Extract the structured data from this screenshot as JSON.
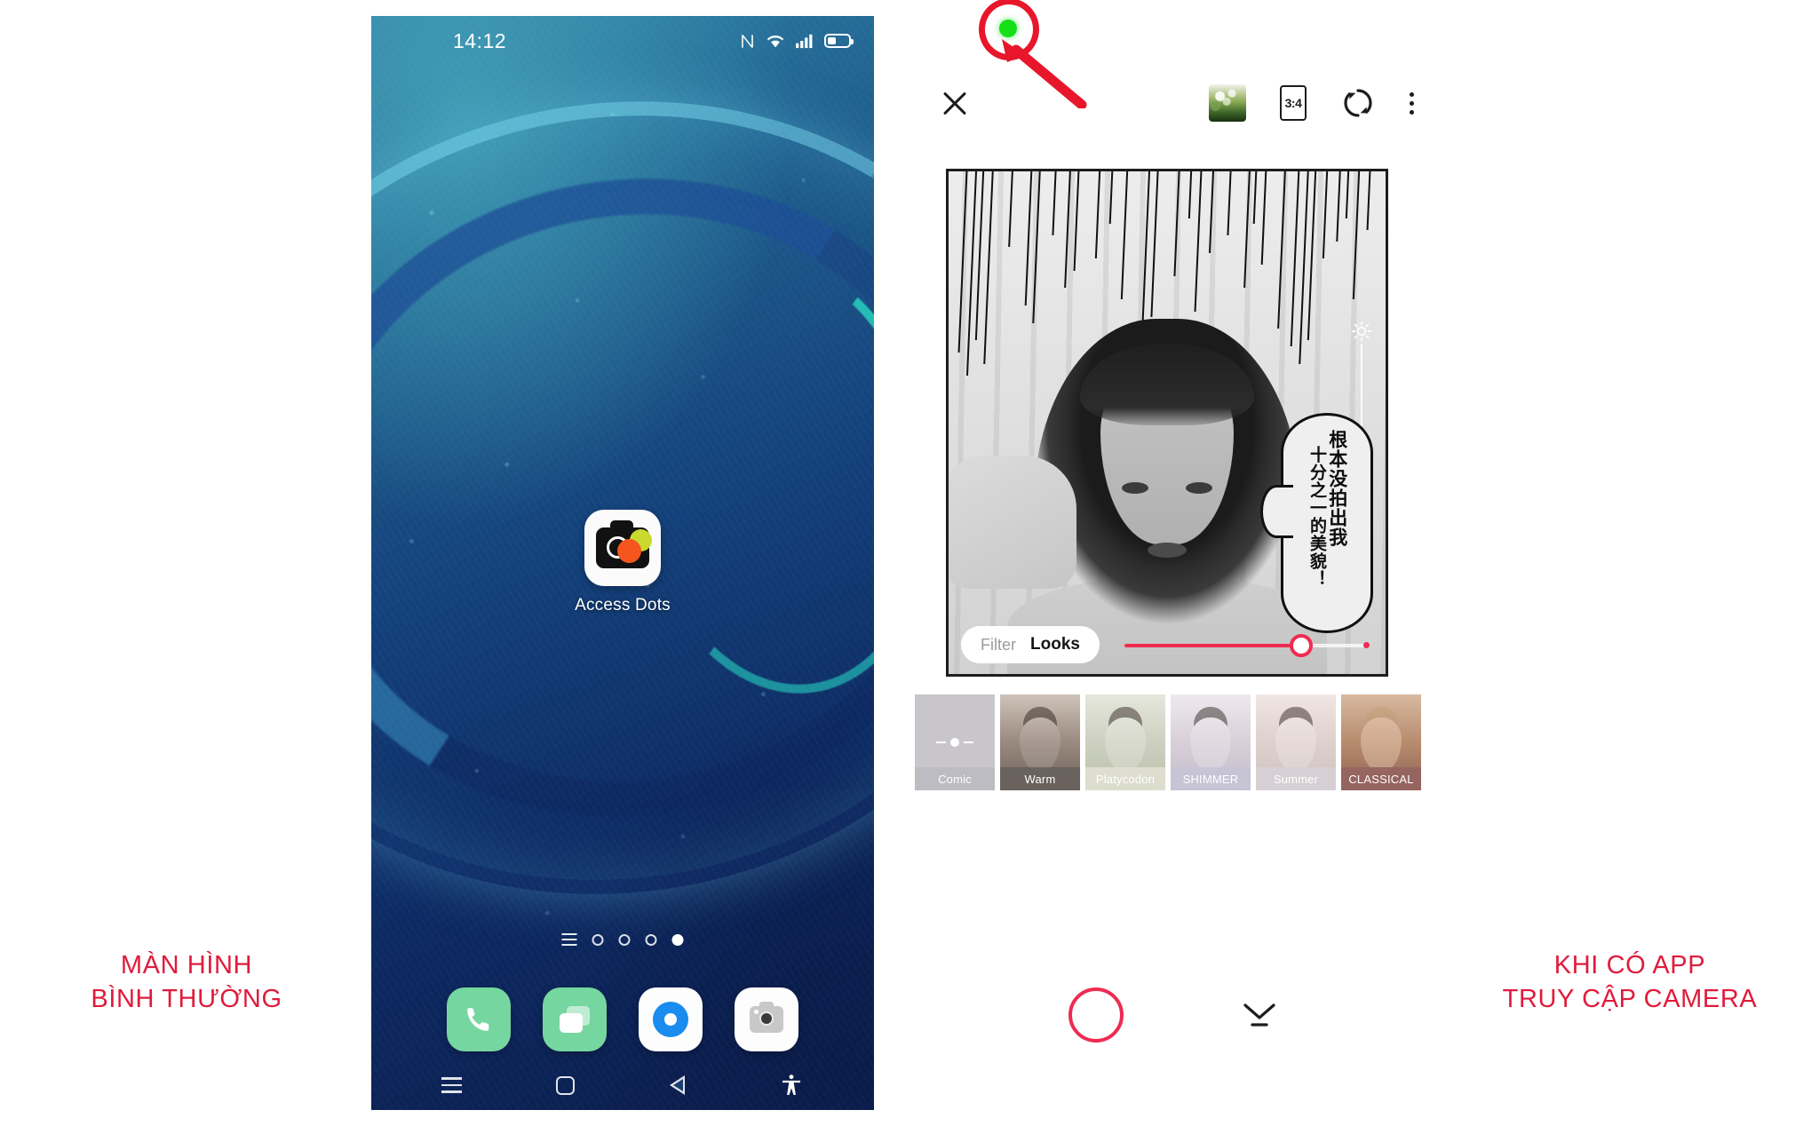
{
  "phone_home": {
    "status_bar": {
      "clock": "14:12",
      "icons": [
        "nfc-icon",
        "wifi-icon",
        "signal-icon",
        "battery-icon"
      ]
    },
    "app": {
      "label": "Access Dots",
      "icon": "access-dots-app-icon"
    },
    "page_indicator": {
      "total": 4,
      "active_index": 3,
      "menu_glyph": "list-icon"
    },
    "dock": [
      {
        "name": "phone",
        "icon": "phone-icon",
        "color": "#76d6a0"
      },
      {
        "name": "messages",
        "icon": "messages-icon",
        "color": "#76d6a0"
      },
      {
        "name": "browser",
        "icon": "browser-icon",
        "color": "#1a8cf0"
      },
      {
        "name": "camera",
        "icon": "camera-icon",
        "color": "#c8c8c8"
      }
    ],
    "nav_bar": [
      {
        "name": "recents",
        "icon": "menu-icon"
      },
      {
        "name": "home",
        "icon": "home-square-icon"
      },
      {
        "name": "back",
        "icon": "back-triangle-icon"
      },
      {
        "name": "accessibility",
        "icon": "accessibility-icon"
      }
    ]
  },
  "camera_app": {
    "toolbar": {
      "close_icon": "close-icon",
      "gallery_icon": "gallery-thumbnail-icon",
      "aspect_ratio": "3:4",
      "flip_icon": "switch-camera-icon",
      "more_icon": "more-options-icon"
    },
    "access_indicator": {
      "label": "camera-in-use-dot",
      "color": "#15e016",
      "annotation_color": "#e8162b"
    },
    "viewfinder": {
      "speech_bubble_line_1": "根本没拍出我",
      "speech_bubble_line_2": "十分之一的美貌！",
      "exposure_icon": "brightness-sun-icon"
    },
    "mode_pill": {
      "inactive": "Filter",
      "active": "Looks"
    },
    "intensity_slider": {
      "value_percent": 72,
      "accent": "#f02b52"
    },
    "filters": [
      {
        "label": "Comic",
        "selected": true
      },
      {
        "label": "Warm",
        "selected": false
      },
      {
        "label": "Platycodon",
        "selected": false
      },
      {
        "label": "SHIMMER",
        "selected": false
      },
      {
        "label": "Summer",
        "selected": false
      },
      {
        "label": "CLASSICAL",
        "selected": false
      }
    ],
    "shutter": {
      "name": "shutter-button",
      "color": "#ef2b52"
    },
    "collapse_icon": "chevron-down-collapse-icon"
  },
  "captions": {
    "left_line_1": "MÀN HÌNH",
    "left_line_2": "BÌNH THƯỜNG",
    "right_line_1": "KHI CÓ APP",
    "right_line_2": "TRUY CẬP CAMERA",
    "color": "#e01b3c"
  }
}
